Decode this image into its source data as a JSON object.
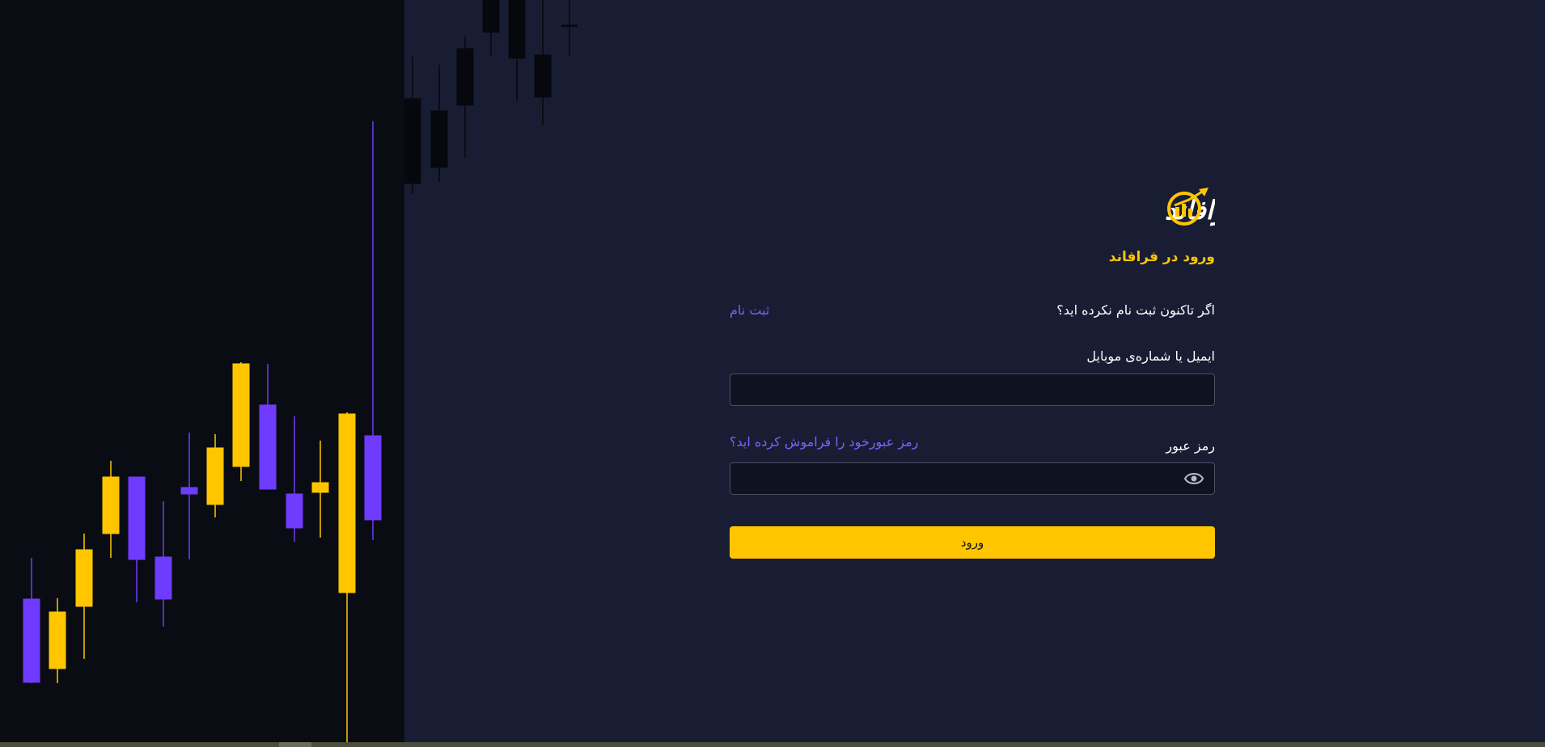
{
  "brand": {
    "logo_text": "فرافاند",
    "accent": "#ffc600",
    "link_color": "#7b61ff",
    "chart_purple": "#6f3bff"
  },
  "login": {
    "title": "ورود در فرافاند",
    "register_prompt": "اگر تاکنون ثبت نام نکرده اید؟",
    "register_link": "ثبت نام",
    "email_label": "ایمیل یا شماره‌ی موبایل",
    "email_value": "",
    "password_label": "رمز عبور",
    "password_value": "",
    "forgot_link": "رمز عبورخود را فراموش کرده اید؟",
    "submit_label": "ورود",
    "password_toggle_icon": "eye-icon"
  }
}
